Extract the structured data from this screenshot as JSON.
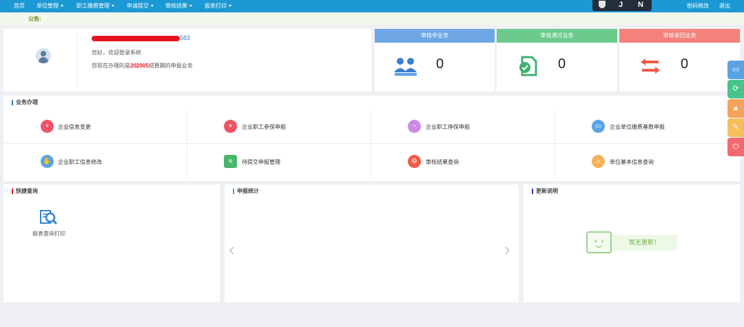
{
  "nav": {
    "items": [
      {
        "label": "首页",
        "dropdown": false
      },
      {
        "label": "单位管理",
        "dropdown": true
      },
      {
        "label": "职工缴费管理",
        "dropdown": true
      },
      {
        "label": "申请提交",
        "dropdown": true
      },
      {
        "label": "审核结果",
        "dropdown": true
      },
      {
        "label": "报表打印",
        "dropdown": true
      }
    ],
    "password_label": "密码修改",
    "logout_label": "退出",
    "ime": {
      "key1": "J",
      "key2": "N"
    }
  },
  "notice": {
    "label": "公告:"
  },
  "user": {
    "name_suffix": "583",
    "greeting": "您好，欢迎登录系统",
    "period_prefix": "您现在办理的是",
    "period": "202005",
    "period_suffix": "结算期的申报业务"
  },
  "stats": [
    {
      "title": "审核中业务",
      "value": "0",
      "color": "#6fa7e6",
      "icon": "people-icon"
    },
    {
      "title": "审核通过业务",
      "value": "0",
      "color": "#6ccb8c",
      "icon": "doc-check-icon"
    },
    {
      "title": "审核退回业务",
      "value": "0",
      "color": "#f2827a",
      "icon": "return-arrows-icon"
    }
  ],
  "business": {
    "title": "业务办理",
    "items": [
      {
        "label": "企业信息变更",
        "color": "#ef5466",
        "icon": "user-add-icon"
      },
      {
        "label": "企业职工参保申报",
        "color": "#ef5466",
        "icon": "user-add-icon"
      },
      {
        "label": "企业职工停保申报",
        "color": "#c98ae6",
        "icon": "user-remove-icon"
      },
      {
        "label": "企业单位缴费基数申报",
        "color": "#5aa4e6",
        "icon": "card-icon"
      },
      {
        "label": "企业职工信息修改",
        "color": "#5aa4e6",
        "icon": "hand-icon"
      },
      {
        "label": "待提交申报管理",
        "color": "#47b86a",
        "icon": "id-card-icon"
      },
      {
        "label": "审核结果查询",
        "color": "#f15a45",
        "icon": "gear-icon"
      },
      {
        "label": "单位基本信息查询",
        "color": "#f4b35a",
        "icon": "search-icon"
      }
    ]
  },
  "quick": {
    "title": "快捷查询",
    "item": "报表查询打印"
  },
  "report_stats": {
    "title": "申报统计"
  },
  "updates": {
    "title": "更新说明",
    "empty": "暂无更新！"
  },
  "sidebar": [
    {
      "icon": "chat-icon",
      "color": "#5aa4e6"
    },
    {
      "icon": "refresh-icon",
      "color": "#47c48a"
    },
    {
      "icon": "lock-icon",
      "color": "#f5a35a"
    },
    {
      "icon": "edit-doc-icon",
      "color": "#f5bf5a"
    },
    {
      "icon": "power-icon",
      "color": "#f2696e"
    }
  ]
}
